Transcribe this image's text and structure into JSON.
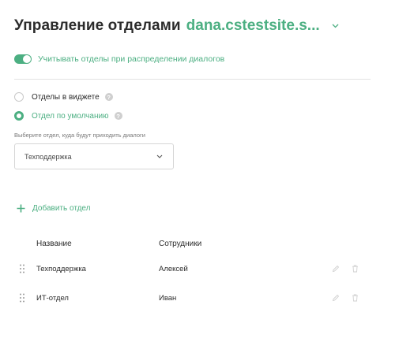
{
  "header": {
    "title": "Управление отделами",
    "site": "dana.cstestsite.s..."
  },
  "toggle": {
    "label": "Учитывать отделы при распределении диалогов",
    "enabled": true
  },
  "mode": {
    "options": [
      {
        "label": "Отделы в виджете",
        "checked": false
      },
      {
        "label": "Отдел по умолчанию",
        "checked": true
      }
    ],
    "help_glyph": "?"
  },
  "default_department": {
    "label": "Выберите отдел, куда будут приходить диалоги",
    "value": "Техподдержка"
  },
  "add_button": {
    "label": "Добавить отдел"
  },
  "table": {
    "columns": [
      "Название",
      "Сотрудники"
    ],
    "rows": [
      {
        "name": "Техподдержка",
        "staff": "Алексей"
      },
      {
        "name": "ИТ-отдел",
        "staff": "Иван"
      }
    ]
  },
  "colors": {
    "accent": "#4caf82",
    "text": "#2b2b2b",
    "muted": "#c9c9c9"
  },
  "icons": {
    "site_dropdown": "chevron-down-icon",
    "select_dropdown": "chevron-down-icon",
    "add": "plus-icon",
    "help": "question-icon",
    "drag": "drag-handle-icon",
    "edit": "pencil-icon",
    "delete": "trash-icon"
  }
}
